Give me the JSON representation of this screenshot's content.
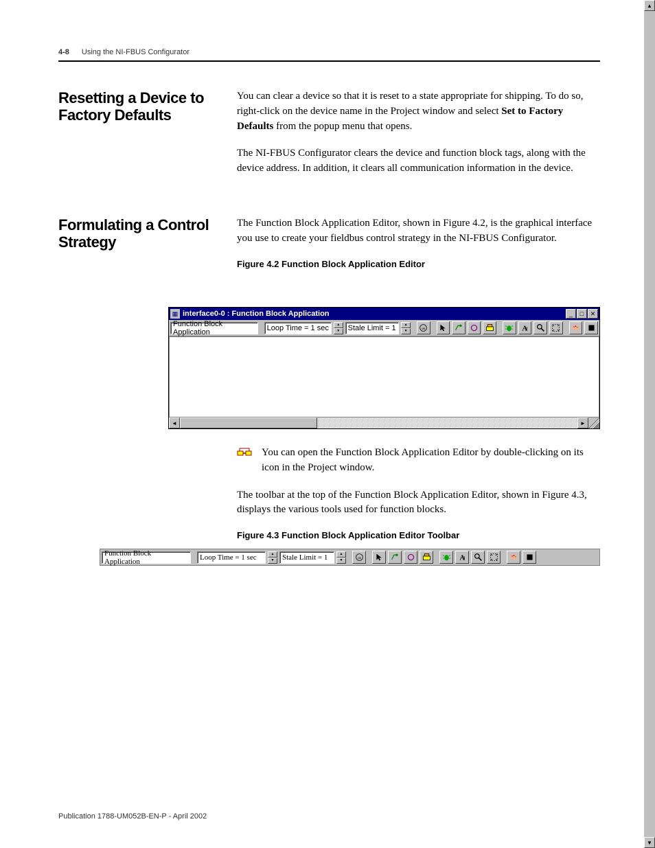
{
  "header": {
    "page_number": "4-8",
    "chapter_title": "Using the NI-FBUS Configurator"
  },
  "section1": {
    "heading": "Resetting a Device to Factory Defaults",
    "para1a": "You can clear a device so that it is reset to a state appropriate for shipping. To do so, right-click on the device name in the Project window and select ",
    "para1_bold": "Set to Factory Defaults",
    "para1b": " from the popup menu that opens.",
    "para2": "The NI-FBUS Configurator clears the device and function block tags, along with the device address. In addition, it clears all communication information in the device."
  },
  "section2": {
    "heading": "Formulating a Control Strategy",
    "para1": "The Function Block Application Editor, shown in Figure 4.2, is the graphical interface you use to create your fieldbus control strategy in the NI-FBUS Configurator."
  },
  "figure42": {
    "caption": "Figure 4.2 Function Block Application Editor",
    "window_title": "interface0-0 : Function Block Application",
    "field_app": "Function Block Application",
    "field_loop": "Loop Time = 1 sec",
    "field_stale": "Stale Limit = 1"
  },
  "icon_para": "You can open the Function Block Application Editor by double-clicking on its icon in the Project window.",
  "toolbar_para": "The toolbar at the top of the Function Block Application Editor, shown in Figure 4.3, displays the various tools used for function blocks.",
  "figure43": {
    "caption": "Figure 4.3 Function Block Application Editor Toolbar",
    "field_app": "Function Block Application",
    "field_loop": "Loop Time = 1 sec",
    "field_stale": "Stale Limit = 1"
  },
  "footer": "Publication 1788-UM052B-EN-P - April 2002"
}
